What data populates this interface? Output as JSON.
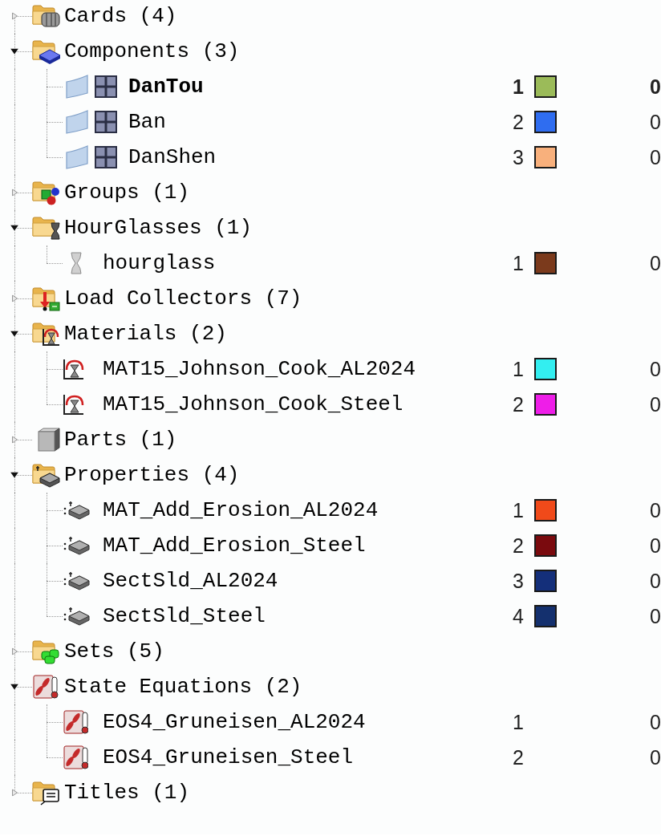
{
  "tree": [
    {
      "kind": "cards",
      "label": "Cards (4)",
      "expanded": false
    },
    {
      "kind": "components",
      "label": "Components (3)",
      "expanded": true,
      "children": [
        {
          "kind": "component",
          "label": "DanTou",
          "current": true,
          "id": "1",
          "color": "#9bbb59",
          "value": "0"
        },
        {
          "kind": "component",
          "label": "Ban",
          "current": false,
          "id": "2",
          "color": "#2f6df0",
          "value": "0"
        },
        {
          "kind": "component",
          "label": "DanShen",
          "current": false,
          "id": "3",
          "color": "#f8b07c",
          "value": "0"
        }
      ]
    },
    {
      "kind": "groups",
      "label": "Groups (1)",
      "expanded": false
    },
    {
      "kind": "hourglasses",
      "label": "HourGlasses (1)",
      "expanded": true,
      "children": [
        {
          "kind": "hourglass",
          "label": "hourglass",
          "id": "1",
          "color": "#7b3a1c",
          "value": "0"
        }
      ]
    },
    {
      "kind": "load_collectors",
      "label": "Load Collectors (7)",
      "expanded": false
    },
    {
      "kind": "materials",
      "label": "Materials (2)",
      "expanded": true,
      "children": [
        {
          "kind": "material",
          "label": "MAT15_Johnson_Cook_AL2024",
          "id": "1",
          "color": "#33eef0",
          "value": "0"
        },
        {
          "kind": "material",
          "label": "MAT15_Johnson_Cook_Steel",
          "id": "2",
          "color": "#ee1ee8",
          "value": "0"
        }
      ]
    },
    {
      "kind": "parts",
      "label": "Parts (1)",
      "expanded": false
    },
    {
      "kind": "properties",
      "label": "Properties (4)",
      "expanded": true,
      "children": [
        {
          "kind": "property",
          "label": "MAT_Add_Erosion_AL2024",
          "id": "1",
          "color": "#f04a1a",
          "value": "0"
        },
        {
          "kind": "property",
          "label": "MAT_Add_Erosion_Steel",
          "id": "2",
          "color": "#7a0a0e",
          "value": "0"
        },
        {
          "kind": "property",
          "label": "SectSld_AL2024",
          "id": "3",
          "color": "#142f7a",
          "value": "0"
        },
        {
          "kind": "property",
          "label": "SectSld_Steel",
          "id": "4",
          "color": "#14306e",
          "value": "0"
        }
      ]
    },
    {
      "kind": "sets",
      "label": "Sets (5)",
      "expanded": false
    },
    {
      "kind": "state_equations",
      "label": "State Equations (2)",
      "expanded": true,
      "children": [
        {
          "kind": "eos",
          "label": "EOS4_Gruneisen_AL2024",
          "id": "1",
          "value": "0"
        },
        {
          "kind": "eos",
          "label": "EOS4_Gruneisen_Steel",
          "id": "2",
          "value": "0"
        }
      ]
    },
    {
      "kind": "titles",
      "label": "Titles (1)",
      "expanded": false
    }
  ]
}
